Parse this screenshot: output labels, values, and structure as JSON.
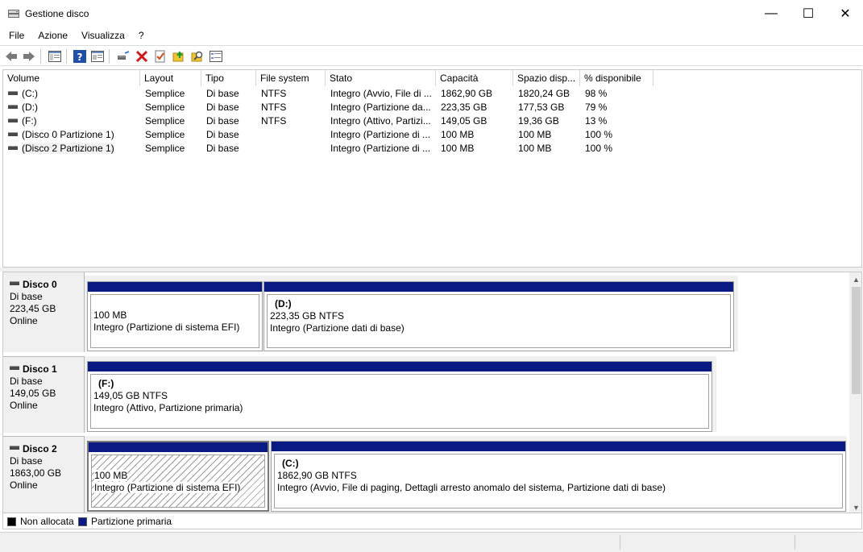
{
  "window": {
    "title": "Gestione disco",
    "minimize_glyph": "—",
    "maximize_glyph": "☐",
    "close_glyph": "✕"
  },
  "menu": [
    "File",
    "Azione",
    "Visualizza",
    "?"
  ],
  "toolbar": {
    "icons": [
      "back-icon",
      "forward-icon",
      "console-tree-icon",
      "help-icon",
      "properties-view-icon",
      "connect-disk-icon",
      "delete-icon",
      "check-icon",
      "open-folder-icon",
      "explore-icon",
      "settings-list-icon"
    ]
  },
  "table": {
    "columns": [
      "Volume",
      "Layout",
      "Tipo",
      "File system",
      "Stato",
      "Capacità",
      "Spazio disp...",
      "% disponibile"
    ],
    "rows": [
      [
        "(C:)",
        "Semplice",
        "Di base",
        "NTFS",
        "Integro (Avvio, File di ...",
        "1862,90 GB",
        "1820,24 GB",
        "98 %"
      ],
      [
        "(D:)",
        "Semplice",
        "Di base",
        "NTFS",
        "Integro (Partizione da...",
        "223,35 GB",
        "177,53 GB",
        "79 %"
      ],
      [
        "(F:)",
        "Semplice",
        "Di base",
        "NTFS",
        "Integro (Attivo, Partizi...",
        "149,05 GB",
        "19,36 GB",
        "13 %"
      ],
      [
        "(Disco 0 Partizione 1)",
        "Semplice",
        "Di base",
        "",
        "Integro (Partizione di ...",
        "100 MB",
        "100 MB",
        "100 %"
      ],
      [
        "(Disco 2 Partizione 1)",
        "Semplice",
        "Di base",
        "",
        "Integro (Partizione di ...",
        "100 MB",
        "100 MB",
        "100 %"
      ]
    ]
  },
  "disks": [
    {
      "name": "Disco 0",
      "type": "Di base",
      "size": "223,45 GB",
      "status": "Online",
      "partitions": [
        {
          "label": "",
          "size": "100 MB",
          "state": "Integro (Partizione di sistema EFI)"
        },
        {
          "label": "(D:)",
          "size": "223,35 GB NTFS",
          "state": "Integro (Partizione dati di base)"
        }
      ]
    },
    {
      "name": "Disco 1",
      "type": "Di base",
      "size": "149,05 GB",
      "status": "Online",
      "partitions": [
        {
          "label": "(F:)",
          "size": "149,05 GB NTFS",
          "state": "Integro (Attivo, Partizione primaria)"
        }
      ]
    },
    {
      "name": "Disco 2",
      "type": "Di base",
      "size": "1863,00 GB",
      "status": "Online",
      "partitions": [
        {
          "label": "",
          "size": "100 MB",
          "state": "Integro (Partizione di sistema EFI)"
        },
        {
          "label": "(C:)",
          "size": "1862,90 GB NTFS",
          "state": "Integro (Avvio, File di paging, Dettagli arresto anomalo del sistema, Partizione dati di base)"
        }
      ]
    }
  ],
  "legend": [
    {
      "label": "Non allocata",
      "color": "#000000"
    },
    {
      "label": "Partizione primaria",
      "color": "#0a1a84"
    }
  ],
  "colors": {
    "primary_partition": "#0a1a84",
    "unallocated": "#000000"
  }
}
